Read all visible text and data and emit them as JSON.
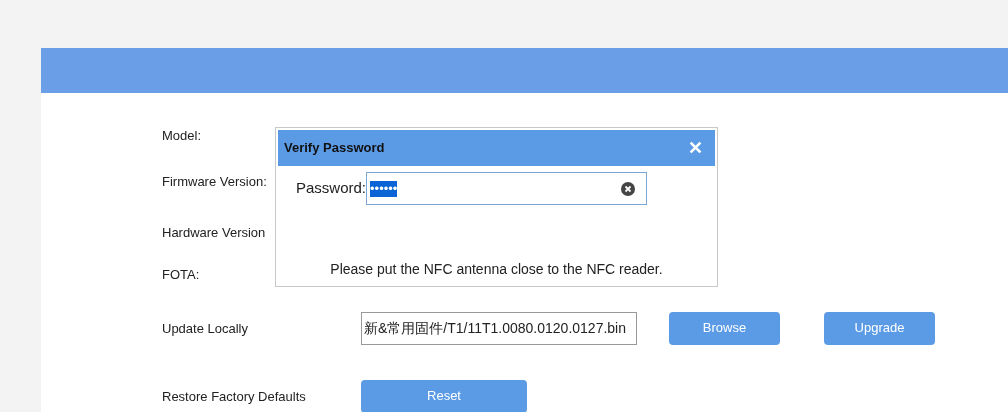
{
  "rows": [
    {
      "kind": "text",
      "label": "Model:"
    },
    {
      "kind": "text",
      "label": "Firmware Version:"
    },
    {
      "kind": "text",
      "label": "Hardware Version"
    },
    {
      "kind": "text",
      "label": "FOTA:"
    },
    {
      "kind": "file",
      "label": "Update Locally",
      "value": "新&常用固件/T1/11T1.0080.0120.0127.bin",
      "buttons": [
        "Browse",
        "Upgrade"
      ]
    },
    {
      "kind": "button",
      "label": "Restore Factory Defaults",
      "buttons": [
        "Reset"
      ]
    }
  ],
  "dialog": {
    "title": "Verify Password",
    "close": "✕",
    "field_label": "Password:",
    "value": "••••••",
    "message": "Please put the NFC antenna close to the NFC reader."
  }
}
